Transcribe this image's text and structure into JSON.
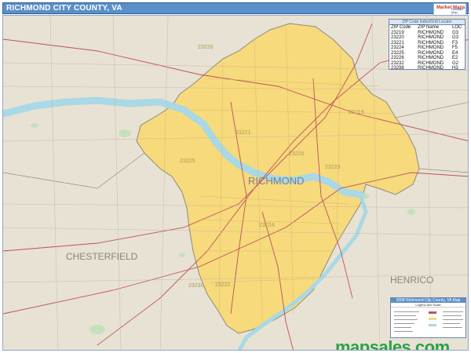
{
  "header": {
    "title": "RICHMOND CITY COUNTY, VA"
  },
  "brand": {
    "logo_text": "Market Maps",
    "logo_sub": "Detailed Map Solutions"
  },
  "map": {
    "city_name": "RICHMOND",
    "counties": {
      "west": "CHESTERFIELD",
      "east": "HENRICO"
    },
    "zip_labels": [
      "23226",
      "23221",
      "23220",
      "23223",
      "23225",
      "23224",
      "23222",
      "23219",
      "23230"
    ],
    "colors": {
      "city_fill": "#f6da7c",
      "surrounding_land": "#e7e2d3",
      "water": "#a9d8e6",
      "boundary": "#8e8a7c",
      "roads": "#c0505a",
      "parks": "#b8dcb0"
    }
  },
  "zip_index": {
    "title": "ZIP Code Index/Grid Locator",
    "columns": [
      "ZIP Code",
      "ZIP Name",
      "LOC"
    ],
    "rows": [
      [
        "23219",
        "RICHMOND",
        "G3"
      ],
      [
        "23220",
        "RICHMOND",
        "G3"
      ],
      [
        "23221",
        "RICHMOND",
        "F3"
      ],
      [
        "23224",
        "RICHMOND",
        "F5"
      ],
      [
        "23225",
        "RICHMOND",
        "E4"
      ],
      [
        "23226",
        "RICHMOND",
        "E2"
      ],
      [
        "23232",
        "RICHMOND",
        "G2"
      ],
      [
        "23298",
        "RICHMOND",
        "H3"
      ]
    ]
  },
  "legend": {
    "title": "2008 Richmond City County, VA Map",
    "subtitle": "Legend and Scale"
  },
  "footer": {
    "site_name": "mapsales",
    "site_tld": ".com"
  }
}
